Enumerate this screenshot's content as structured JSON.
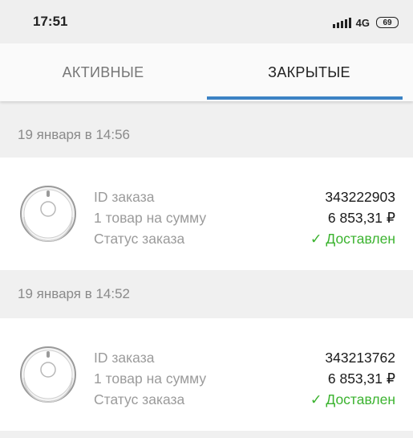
{
  "status_bar": {
    "time": "17:51",
    "network": "4G",
    "battery": "69"
  },
  "tabs": [
    {
      "label": "АКТИВНЫЕ",
      "active": false
    },
    {
      "label": "ЗАКРЫТЫЕ",
      "active": true
    }
  ],
  "accent_color": "#3b82c4",
  "status_color": "#3bb32f",
  "orders": [
    {
      "date": "19 января в 14:56",
      "id_label": "ID заказа",
      "id_value": "343222903",
      "sum_label": "1 товар на сумму",
      "sum_value": "6 853,31 ₽",
      "status_label": "Статус заказа",
      "status_value": "✓ Доставлен",
      "image": "robot-vacuum-icon"
    },
    {
      "date": "19 января в 14:52",
      "id_label": "ID заказа",
      "id_value": "343213762",
      "sum_label": "1 товар на сумму",
      "sum_value": "6 853,31 ₽",
      "status_label": "Статус заказа",
      "status_value": "✓ Доставлен",
      "image": "robot-vacuum-icon"
    }
  ]
}
